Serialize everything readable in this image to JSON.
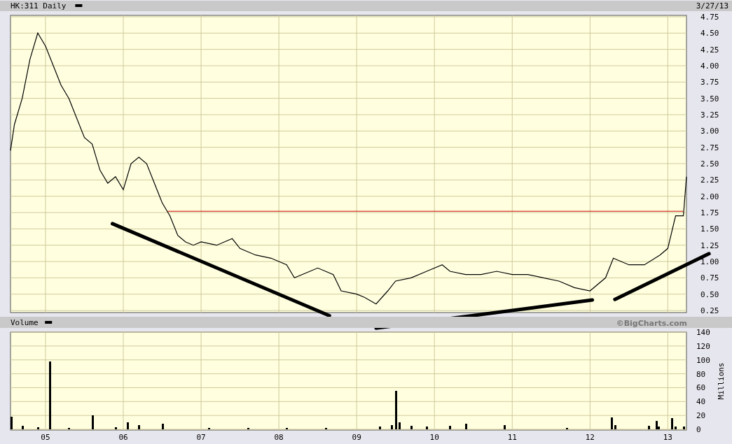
{
  "header": {
    "title": "HK:311 Daily",
    "date": "3/27/13"
  },
  "price_panel": {
    "chart_data": {
      "type": "line",
      "x": [
        2004.55,
        2004.6,
        2004.7,
        2004.8,
        2004.9,
        2005.0,
        2005.1,
        2005.2,
        2005.3,
        2005.4,
        2005.5,
        2005.6,
        2005.7,
        2005.8,
        2005.9,
        2006.0,
        2006.1,
        2006.2,
        2006.3,
        2006.4,
        2006.5,
        2006.6,
        2006.7,
        2006.8,
        2006.9,
        2007.0,
        2007.2,
        2007.4,
        2007.5,
        2007.7,
        2007.9,
        2008.1,
        2008.2,
        2008.4,
        2008.5,
        2008.7,
        2008.8,
        2009.0,
        2009.1,
        2009.25,
        2009.4,
        2009.5,
        2009.7,
        2009.9,
        2010.1,
        2010.2,
        2010.4,
        2010.6,
        2010.8,
        2011.0,
        2011.2,
        2011.4,
        2011.6,
        2011.8,
        2012.0,
        2012.2,
        2012.3,
        2012.5,
        2012.7,
        2012.9,
        2013.0,
        2013.1,
        2013.2,
        2013.24
      ],
      "series": [
        {
          "color": "#000000",
          "values": [
            2.7,
            3.1,
            3.5,
            4.1,
            4.5,
            4.3,
            4.0,
            3.7,
            3.5,
            3.2,
            2.9,
            2.8,
            2.4,
            2.2,
            2.3,
            2.1,
            2.5,
            2.6,
            2.5,
            2.2,
            1.9,
            1.7,
            1.4,
            1.3,
            1.25,
            1.3,
            1.25,
            1.35,
            1.2,
            1.1,
            1.05,
            0.95,
            0.75,
            0.85,
            0.9,
            0.8,
            0.55,
            0.5,
            0.45,
            0.35,
            0.55,
            0.7,
            0.75,
            0.85,
            0.95,
            0.85,
            0.8,
            0.8,
            0.85,
            0.8,
            0.8,
            0.75,
            0.7,
            0.6,
            0.55,
            0.75,
            1.05,
            0.95,
            0.95,
            1.1,
            1.2,
            1.7,
            1.7,
            2.3
          ]
        }
      ],
      "xlim": [
        2004.55,
        2013.24
      ],
      "ylim": [
        0.25,
        4.75
      ],
      "grid": true,
      "yticks": [
        {
          "value": 4.75,
          "label": "4.75"
        },
        {
          "value": 4.5,
          "label": "4.50"
        },
        {
          "value": 4.25,
          "label": "4.25"
        },
        {
          "value": 4,
          "label": "4.00"
        },
        {
          "value": 3.75,
          "label": "3.75"
        },
        {
          "value": 3.5,
          "label": "3.50"
        },
        {
          "value": 3.25,
          "label": "3.25"
        },
        {
          "value": 3,
          "label": "3.00"
        },
        {
          "value": 2.75,
          "label": "2.75"
        },
        {
          "value": 2.5,
          "label": "2.50"
        },
        {
          "value": 2.25,
          "label": "2.25"
        },
        {
          "value": 2,
          "label": "2.00"
        },
        {
          "value": 1.75,
          "label": "1.75"
        },
        {
          "value": 1.5,
          "label": "1.50"
        },
        {
          "value": 1.25,
          "label": "1.25"
        },
        {
          "value": 1,
          "label": "1.00"
        },
        {
          "value": 0.75,
          "label": "0.75"
        },
        {
          "value": 0.5,
          "label": "0.50"
        },
        {
          "value": 0.25,
          "label": "0.25"
        }
      ]
    }
  },
  "volume_header": {
    "title": "Volume",
    "credit": "©BigCharts.com"
  },
  "volume_panel": {
    "chart_data": {
      "type": "bar",
      "ylabel": "Millions",
      "x": [
        2004.56,
        2004.7,
        2004.9,
        2005.05,
        2005.3,
        2005.6,
        2005.9,
        2006.05,
        2006.2,
        2006.5,
        2007.1,
        2007.6,
        2008.1,
        2008.6,
        2009.3,
        2009.45,
        2009.5,
        2009.55,
        2009.7,
        2009.9,
        2010.2,
        2010.4,
        2010.9,
        2011.7,
        2012.28,
        2012.32,
        2012.75,
        2012.85,
        2012.88,
        2013.05,
        2013.1,
        2013.2
      ],
      "values": [
        18,
        5,
        3,
        98,
        2,
        20,
        3,
        10,
        6,
        8,
        2,
        2,
        2,
        2,
        4,
        6,
        55,
        10,
        5,
        4,
        5,
        8,
        6,
        2,
        17,
        6,
        5,
        12,
        4,
        16,
        4,
        4
      ],
      "xlim": [
        2004.55,
        2013.24
      ],
      "ylim": [
        0,
        140
      ],
      "grid": true,
      "xticks": [
        {
          "value": 2005,
          "label": "05"
        },
        {
          "value": 2006,
          "label": "06"
        },
        {
          "value": 2007,
          "label": "07"
        },
        {
          "value": 2008,
          "label": "08"
        },
        {
          "value": 2009,
          "label": "09"
        },
        {
          "value": 2010,
          "label": "10"
        },
        {
          "value": 2011,
          "label": "11"
        },
        {
          "value": 2012,
          "label": "12"
        },
        {
          "value": 2013,
          "label": "13"
        }
      ],
      "yticks": [
        0,
        20,
        40,
        60,
        80,
        100,
        120,
        140
      ]
    }
  }
}
